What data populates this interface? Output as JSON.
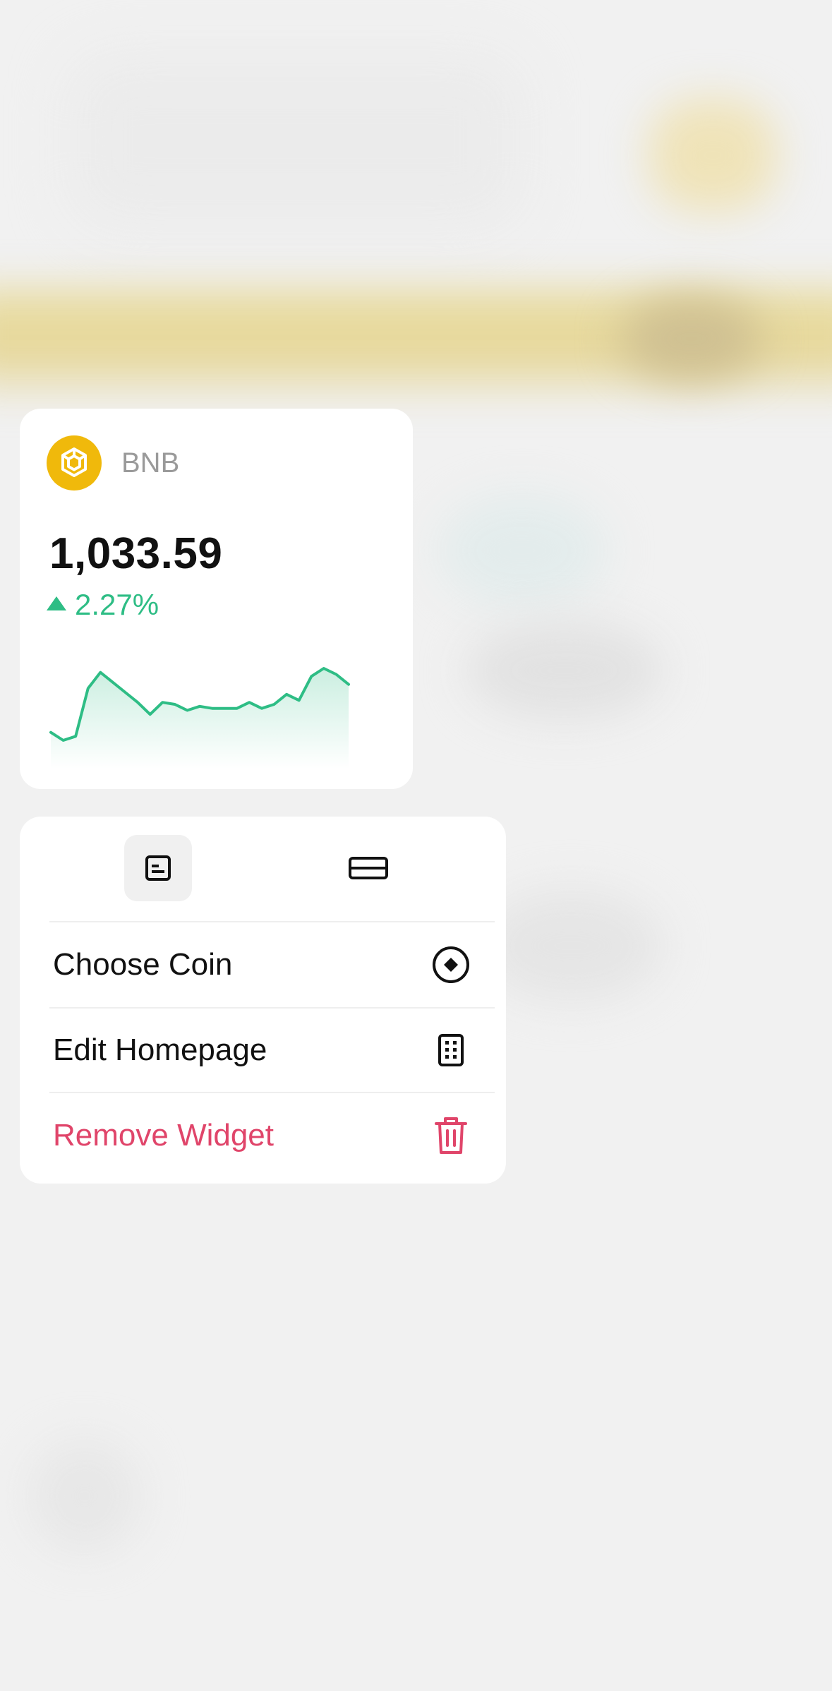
{
  "widget": {
    "coin_symbol": "BNB",
    "coin_icon": "bnb-logo-icon",
    "price": "1,033.59",
    "change_pct": "2.27%",
    "change_direction": "up",
    "sparkline": [
      40,
      36,
      38,
      62,
      70,
      65,
      60,
      55,
      49,
      55,
      54,
      51,
      53,
      52,
      52,
      52,
      55,
      52,
      54,
      59,
      56,
      68,
      72,
      69,
      64
    ]
  },
  "menu": {
    "size_options": [
      {
        "name": "small-size",
        "icon": "small-widget-icon",
        "selected": true
      },
      {
        "name": "wide-size",
        "icon": "wide-widget-icon",
        "selected": false
      }
    ],
    "items": [
      {
        "label": "Choose Coin",
        "icon": "coin-select-icon"
      },
      {
        "label": "Edit Homepage",
        "icon": "edit-grid-icon"
      },
      {
        "label": "Remove Widget",
        "icon": "trash-icon",
        "destructive": true
      }
    ]
  },
  "colors": {
    "accent_green": "#2ebd85",
    "danger_red": "#e0456a",
    "bnb_yellow": "#f0b90b"
  }
}
